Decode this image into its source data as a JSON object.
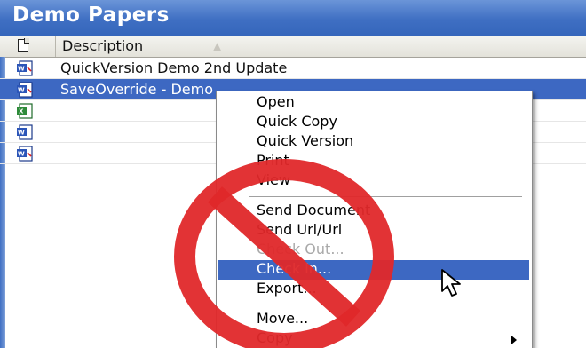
{
  "window": {
    "title": "Demo Papers"
  },
  "table": {
    "header": {
      "description_label": "Description",
      "sort_glyph": "▲"
    },
    "rows": [
      {
        "label": "QuickVersion Demo 2nd Update",
        "icon": "word-doc-icon",
        "selected": false
      },
      {
        "label": "SaveOverride - Demo",
        "icon": "word-doc-icon",
        "selected": true
      },
      {
        "label": "",
        "icon": "excel-doc-icon",
        "selected": false
      },
      {
        "label": "",
        "icon": "word-doc-icon",
        "selected": false
      },
      {
        "label": "",
        "icon": "word-doc-icon",
        "selected": false
      }
    ]
  },
  "context_menu": {
    "items": [
      {
        "label": "Open"
      },
      {
        "label": "Quick Copy"
      },
      {
        "label": "Quick Version"
      },
      {
        "label": "Print"
      },
      {
        "label": "View"
      },
      {
        "label": "Send Document"
      },
      {
        "label": "Send Url/Url"
      },
      {
        "label": "Check Out...",
        "disabled": true
      },
      {
        "label": "Check in...",
        "highlighted": true
      },
      {
        "label": "Export..."
      },
      {
        "label": "Move..."
      },
      {
        "label": "Copy",
        "has_submenu": true
      }
    ]
  },
  "overlay": {
    "icon": "prohibition-sign-icon",
    "color": "#e0282a"
  },
  "colors": {
    "title_bar": "#3f6fc3",
    "selection": "#3d68c2"
  }
}
